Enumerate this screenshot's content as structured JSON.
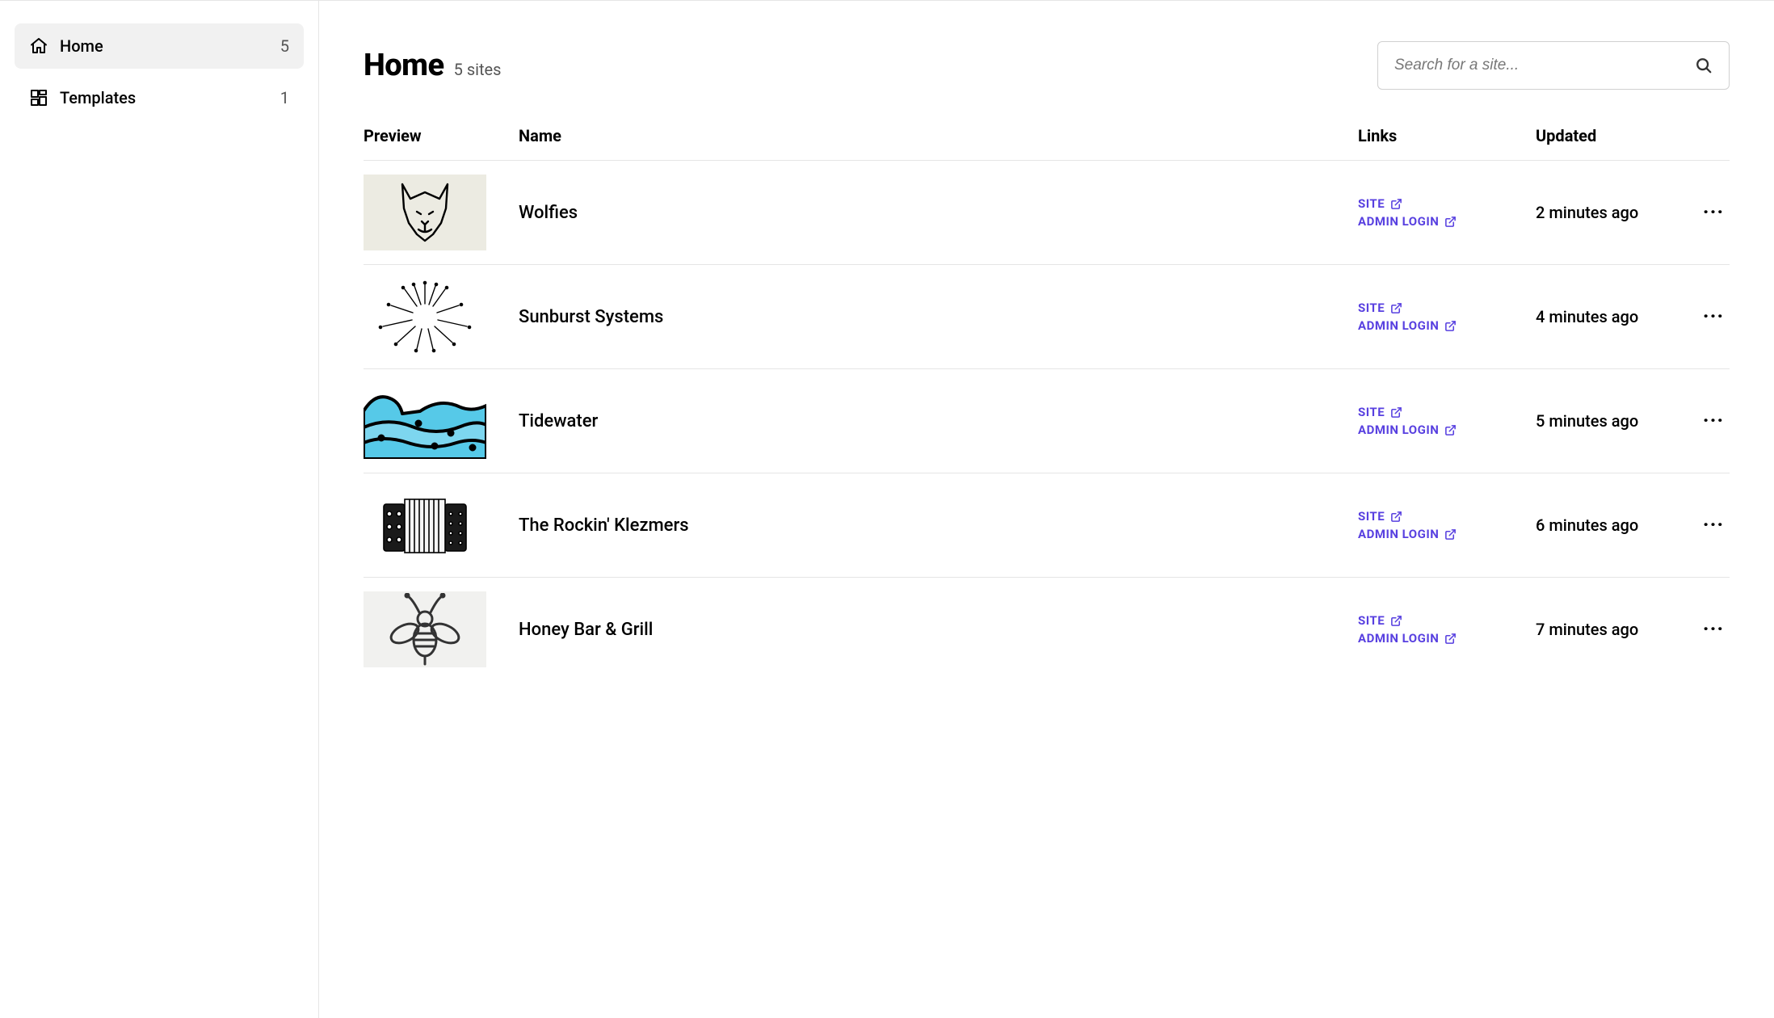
{
  "sidebar": {
    "items": [
      {
        "key": "home",
        "label": "Home",
        "count": "5",
        "active": true,
        "icon": "home"
      },
      {
        "key": "templates",
        "label": "Templates",
        "count": "1",
        "active": false,
        "icon": "templates"
      }
    ]
  },
  "header": {
    "title": "Home",
    "subtitle": "5 sites"
  },
  "search": {
    "placeholder": "Search for a site..."
  },
  "table": {
    "columns": {
      "preview": "Preview",
      "name": "Name",
      "links": "Links",
      "updated": "Updated"
    },
    "link_labels": {
      "site": "SITE",
      "admin": "ADMIN LOGIN"
    },
    "rows": [
      {
        "name": "Wolfies",
        "updated": "2 minutes ago",
        "preview": "wolf"
      },
      {
        "name": "Sunburst Systems",
        "updated": "4 minutes ago",
        "preview": "sunburst"
      },
      {
        "name": "Tidewater",
        "updated": "5 minutes ago",
        "preview": "wave"
      },
      {
        "name": "The Rockin' Klezmers",
        "updated": "6 minutes ago",
        "preview": "accordion"
      },
      {
        "name": "Honey Bar & Grill",
        "updated": "7 minutes ago",
        "preview": "bee"
      }
    ]
  }
}
